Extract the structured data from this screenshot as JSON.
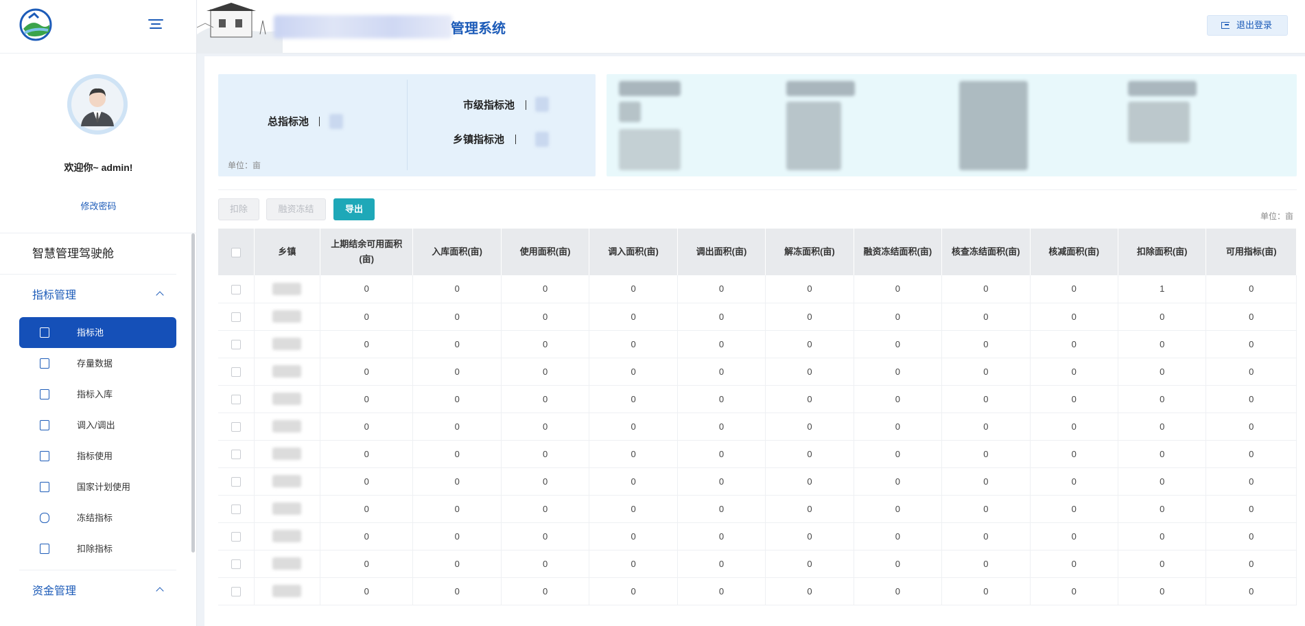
{
  "app": {
    "title": "管理系统"
  },
  "header": {
    "logout_label": "退出登录"
  },
  "profile": {
    "welcome": "欢迎你~ admin!",
    "change_password": "修改密码"
  },
  "sidebar": {
    "group_title": "智慧管理驾驶舱",
    "sections": [
      {
        "label": "指标管理",
        "items": [
          {
            "label": "指标池",
            "active": true
          },
          {
            "label": "存量数据"
          },
          {
            "label": "指标入库"
          },
          {
            "label": "调入/调出"
          },
          {
            "label": "指标使用"
          },
          {
            "label": "国家计划使用"
          },
          {
            "label": "冻结指标"
          },
          {
            "label": "扣除指标"
          }
        ]
      },
      {
        "label": "资金管理"
      }
    ]
  },
  "summary": {
    "total_label": "总指标池",
    "city_label": "市级指标池",
    "town_label": "乡镇指标池",
    "unit": "单位：亩"
  },
  "toolbar": {
    "deduct": "扣除",
    "freeze": "融资冻结",
    "export": "导出",
    "unit": "单位：亩"
  },
  "table": {
    "columns": [
      "乡镇",
      "上期结余可用面积(亩)",
      "入库面积(亩)",
      "使用面积(亩)",
      "调入面积(亩)",
      "调出面积(亩)",
      "解冻面积(亩)",
      "融资冻结面积(亩)",
      "核查冻结面积(亩)",
      "核减面积(亩)",
      "扣除面积(亩)",
      "可用指标(亩)"
    ],
    "rows": [
      [
        "0",
        "0",
        "0",
        "0",
        "0",
        "0",
        "0",
        "0",
        "0",
        "1",
        "0"
      ],
      [
        "0",
        "0",
        "0",
        "0",
        "0",
        "0",
        "0",
        "0",
        "0",
        "0",
        "0"
      ],
      [
        "0",
        "0",
        "0",
        "0",
        "0",
        "0",
        "0",
        "0",
        "0",
        "0",
        "0"
      ],
      [
        "0",
        "0",
        "0",
        "0",
        "0",
        "0",
        "0",
        "0",
        "0",
        "0",
        "0"
      ],
      [
        "0",
        "0",
        "0",
        "0",
        "0",
        "0",
        "0",
        "0",
        "0",
        "0",
        "0"
      ],
      [
        "0",
        "0",
        "0",
        "0",
        "0",
        "0",
        "0",
        "0",
        "0",
        "0",
        "0"
      ],
      [
        "0",
        "0",
        "0",
        "0",
        "0",
        "0",
        "0",
        "0",
        "0",
        "0",
        "0"
      ],
      [
        "0",
        "0",
        "0",
        "0",
        "0",
        "0",
        "0",
        "0",
        "0",
        "0",
        "0"
      ],
      [
        "0",
        "0",
        "0",
        "0",
        "0",
        "0",
        "0",
        "0",
        "0",
        "0",
        "0"
      ],
      [
        "0",
        "0",
        "0",
        "0",
        "0",
        "0",
        "0",
        "0",
        "0",
        "0",
        "0"
      ],
      [
        "0",
        "0",
        "0",
        "0",
        "0",
        "0",
        "0",
        "0",
        "0",
        "0",
        "0"
      ],
      [
        "0",
        "0",
        "0",
        "0",
        "0",
        "0",
        "0",
        "0",
        "0",
        "0",
        "0"
      ]
    ]
  },
  "colors": {
    "primary": "#1550b8",
    "accent": "#1ea8b8",
    "summary_bg": "#e5f1fb",
    "stats_bg": "#e8f8fb"
  }
}
